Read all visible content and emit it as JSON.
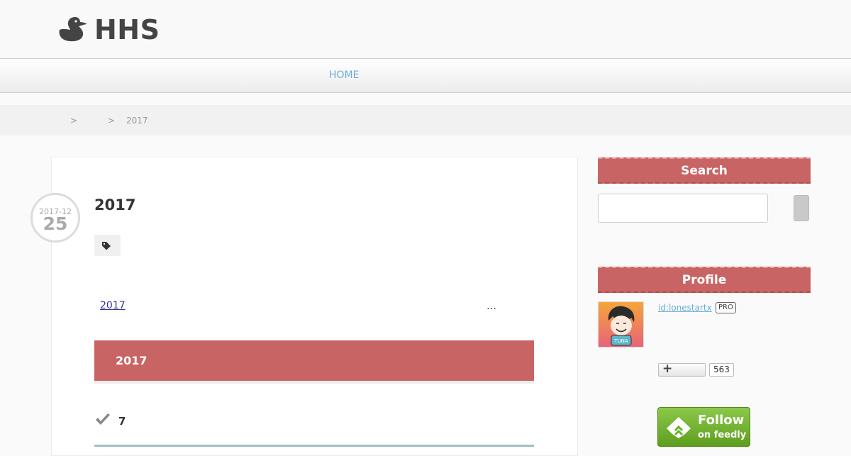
{
  "header": {
    "site_title": "HHS",
    "logo_icon": "duck-icon"
  },
  "nav": {
    "home_label": "HOME"
  },
  "breadcrumb": {
    "separator_1": ">",
    "separator_2": ">",
    "current": "2017"
  },
  "article": {
    "date_year_month": "2017-12",
    "date_day": "25",
    "title": "2017",
    "tag_icon": "tag-icon",
    "entry_link": "2017",
    "ellipsis": "…",
    "section_heading": "2017",
    "check_icon": "checkmark-icon",
    "check_text": "7"
  },
  "sidebar": {
    "search_heading": "Search",
    "search_placeholder": "",
    "profile_heading": "Profile",
    "profile_id": "id:lonestartx",
    "pro_badge": "PRO",
    "subscribe_plus": "+",
    "subscriber_count": "563",
    "feedly_line1": "Follow",
    "feedly_line2": "on feedly"
  },
  "colors": {
    "accent_red": "#c96464",
    "link_blue": "#6aaed6",
    "feedly_green": "#6cb02a"
  }
}
